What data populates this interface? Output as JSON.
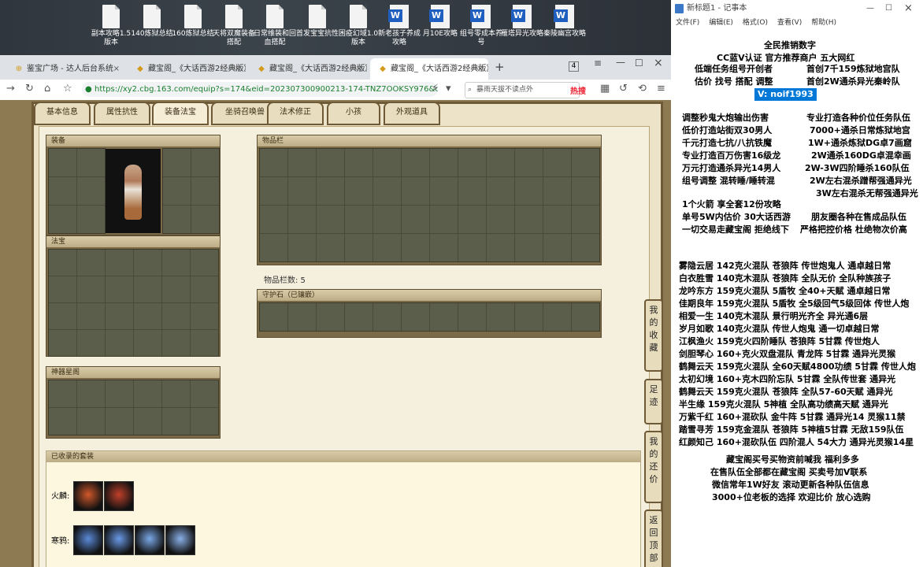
{
  "desktop": {
    "icons": [
      {
        "label": "副本攻略1.5版本",
        "type": "file"
      },
      {
        "label": "140炼狱总结",
        "type": "file"
      },
      {
        "label": "160炼狱总结",
        "type": "file"
      },
      {
        "label": "天将双魔装备搭配",
        "type": "file"
      },
      {
        "label": "日常维装和回血搭配",
        "type": "file"
      },
      {
        "label": "首发宝宝抗性",
        "type": "file"
      },
      {
        "label": "困疫幻域1.0版本",
        "type": "file"
      },
      {
        "label": "新老孩子养成攻略",
        "type": "word"
      },
      {
        "label": "月10E攻略",
        "type": "word"
      },
      {
        "label": "组号零成本养号",
        "type": "word"
      },
      {
        "label": "雁塔异光攻略",
        "type": "word"
      },
      {
        "label": "秦陵幽宫攻略",
        "type": "word"
      }
    ]
  },
  "browser": {
    "tabs": [
      {
        "label": "鉴宝广场 - 达人后台系统"
      },
      {
        "label": "藏宝阁_《大话西游2经典版》"
      },
      {
        "label": "藏宝阁_《大话西游2经典版》"
      },
      {
        "label": "藏宝阁_《大话西游2经典版》"
      }
    ],
    "tab_count": "4",
    "url": "https://xy2.cbg.163.com/equip?s=174&eid=202307300900213-174-TNZ7OOKSY976&o",
    "search_text": "暴雨天拔不读点外",
    "hot_label": "热搜"
  },
  "game": {
    "tabs": [
      "基本信息",
      "属性抗性",
      "装备法宝",
      "坐骑召唤兽",
      "法术修正",
      "小孩",
      "外观道具"
    ],
    "active_tab": "装备法宝",
    "equip_title": "装备",
    "fabao_title": "法宝",
    "xingpan_title": "神器星阁",
    "bag_title": "物品栏",
    "bag_count_label": "物品栏数: 5",
    "shouhu_title": "守护石（已镶嵌）",
    "sets_title": "已收录的套装",
    "set_rows": [
      {
        "label": "火麟:"
      },
      {
        "label": "寒鸦:"
      }
    ],
    "side_buttons": [
      "我的收藏",
      "足迹",
      "我的还价",
      "返回顶部"
    ]
  },
  "notepad": {
    "title": "新标题1 - 记事本",
    "menu": [
      "文件(F)",
      "编辑(E)",
      "格式(O)",
      "查看(V)",
      "帮助(H)"
    ],
    "lines": [
      "全民推销数字",
      "CC蓝V认证 官方推荐商户 五大网红",
      "低端任务组号开创者",
      "首创7千159炼狱地宫队",
      "估价 找号 搭配 调整",
      "首创2W通杀异光秦岭队",
      "V: noif1993",
      "调整秒鬼大炮输出伤害",
      "专业打造各种价位任务队伍",
      "低价打造站街双30男人",
      "7000+通杀日常炼狱地宫",
      "千元打造七抗/八抗铁魔",
      "1W+通杀炼狱DG卓7画窟",
      "专业打造百万伤害16级龙",
      "2W通杀160DG卓混幸画",
      "万元打造通杀异光14男人",
      "2W-3W四阶睡杀160队伍",
      "组号调整 混转睡/睡转混",
      "2W左右混杀蹭帮强通异光",
      "3W左右混杀无帮强通异光",
      "1个火箭 享全套12份攻略",
      "单号5W内估价 30大话西游",
      "朋友圈各种在售成品队伍",
      "一切交易走藏宝阁 拒绝线下",
      "严格把控价格 杜绝物次价高",
      "雾隐云居 142克火混队 苍狼阵 传世炮鬼人 通卓越日常",
      "白衣胜雪 140克木混队 苍狼阵 全队无价 全队种族孩子",
      "龙吟东方 159克火混队 5盾牧 全40+天赋 通卓越日常",
      "佳期良年 159克火混队 5盾牧 全5级回气5级回体 传世人炮",
      "相爱一生 140克木混队 景行明光齐全 异光通6层",
      "岁月如歌 140克火混队 传世人炮鬼 通一切卓越日常",
      "江枫渔火 159克火四阶睡队 苍狼阵 5甘霖 传世炮人",
      "剑胆琴心 160+克火双盘混队 青龙阵 5甘霖 通异光灵猴",
      "鹤舞云天 159克火混队 全60天赋4800功绩 5甘霖 传世人炮",
      "太初幻境 160+克木四阶忘队 5甘霖 全队传世套 通异光",
      "鹤舞云天 159克火混队 苍狼阵 全队57-60天赋 通异光",
      "半生缘 159克火混队 5神植 全队高功绩高天赋 通异光",
      "万紫千红 160+混砍队 金牛阵 5甘霖 通异光14 灵猴11禁",
      "踏雪寻芳 159克金混队 苍狼阵 5神植5甘霖 无敌159队伍",
      "红颜知己 160+混砍队伍 四阶混人 54大力 通异光灵猴14星",
      "藏宝阁买号买物资前喊我 福利多多",
      "在售队伍全部都在藏宝阁 买卖号加V联系",
      "微信常年1W好友 滚动更新各种队伍信息",
      "3000+位老板的选择 欢迎比价 放心选购"
    ]
  },
  "colors": {
    "accent_highlight": "#0078d7",
    "game_frame": "#6e5a36",
    "panel_bg": "#ece3c8"
  }
}
